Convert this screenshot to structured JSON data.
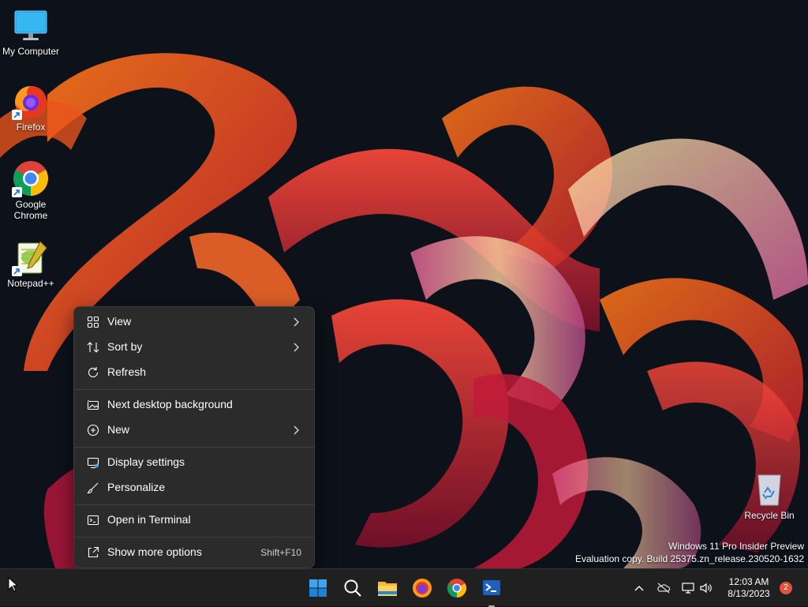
{
  "desktop": {
    "icons": [
      {
        "label": "My Computer",
        "icon": "monitor-icon"
      },
      {
        "label": "Firefox",
        "icon": "firefox-icon"
      },
      {
        "label": "Google Chrome",
        "icon": "chrome-icon"
      },
      {
        "label": "Notepad++",
        "icon": "notepadpp-icon"
      },
      {
        "label": "Recycle Bin",
        "icon": "recycle-bin-icon"
      }
    ],
    "watermark": {
      "line1": "Windows 11 Pro Insider Preview",
      "line2": "Evaluation copy. Build 25375.zn_release.230520-1632"
    }
  },
  "context_menu": {
    "items": [
      {
        "label": "View",
        "icon": "grid-icon",
        "submenu": true
      },
      {
        "label": "Sort by",
        "icon": "sort-icon",
        "submenu": true
      },
      {
        "label": "Refresh",
        "icon": "refresh-icon",
        "submenu": false
      },
      {
        "label": "Next desktop background",
        "icon": "next-background-icon",
        "submenu": false
      },
      {
        "label": "New",
        "icon": "plus-circle-icon",
        "submenu": true
      },
      {
        "label": "Display settings",
        "icon": "display-settings-icon",
        "submenu": false
      },
      {
        "label": "Personalize",
        "icon": "brush-icon",
        "submenu": false
      },
      {
        "label": "Open in Terminal",
        "icon": "terminal-icon",
        "submenu": false
      },
      {
        "label": "Show more options",
        "icon": "share-icon",
        "submenu": false,
        "shortcut": "Shift+F10"
      }
    ]
  },
  "taskbar": {
    "apps": [
      "start-icon",
      "search-icon",
      "file-explorer-icon",
      "firefox-icon",
      "chrome-icon",
      "terminal-icon"
    ],
    "tray": [
      "chevron-up-icon",
      "onedrive-icon",
      "network-icon",
      "volume-icon"
    ],
    "clock": {
      "time": "12:03 AM",
      "date": "8/13/2023"
    },
    "notification_count": "2"
  },
  "colors": {
    "menu_bg": "#2b2b2b",
    "taskbar_bg": "#202020",
    "accent": "#0078d4"
  }
}
